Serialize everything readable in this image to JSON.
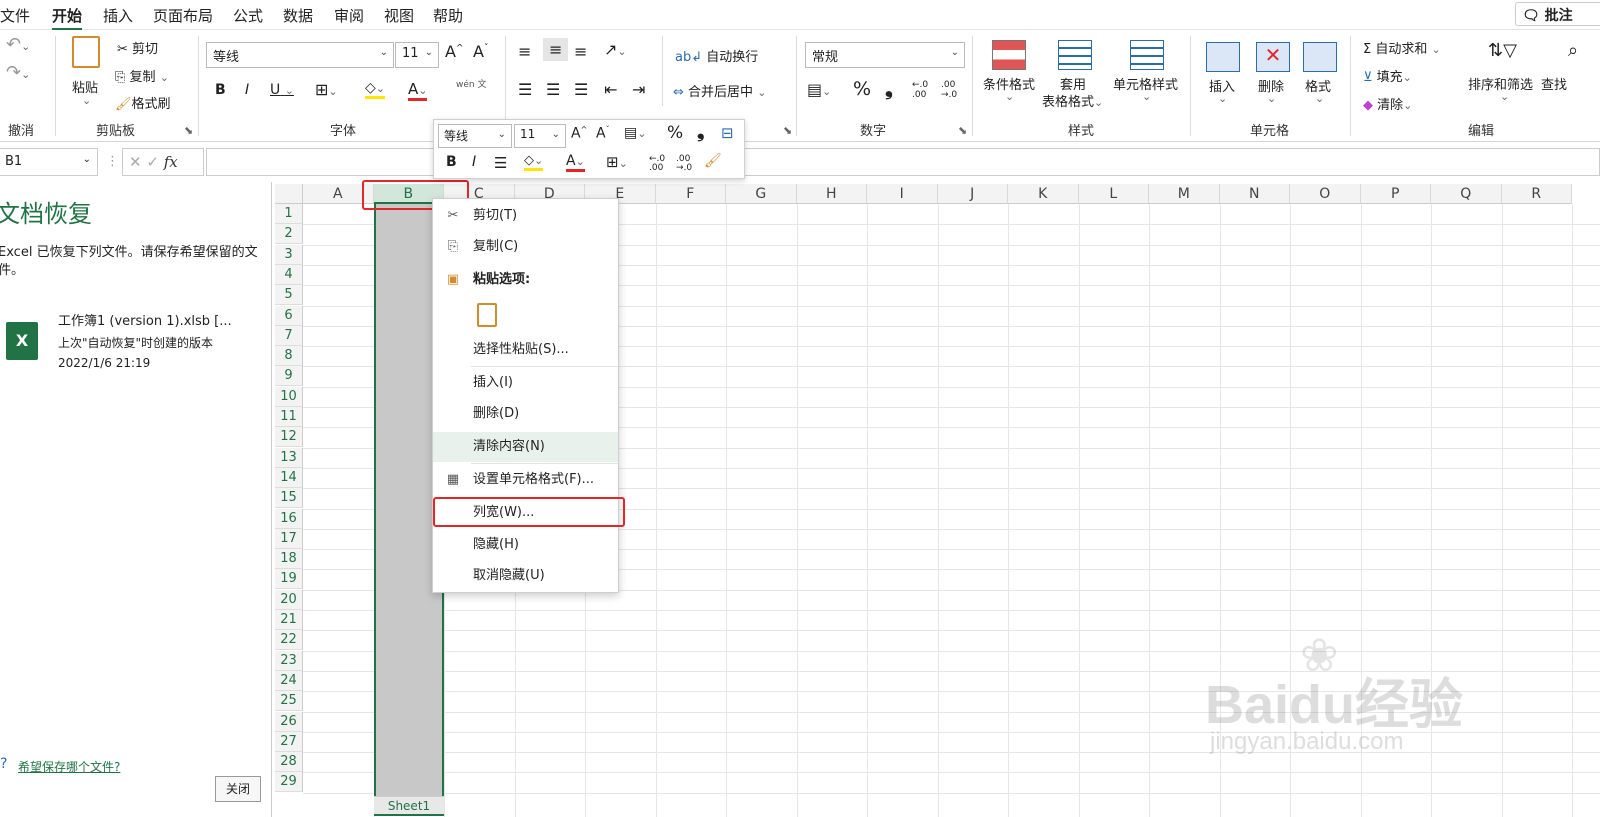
{
  "menu": {
    "tabs": [
      "文件",
      "开始",
      "插入",
      "页面布局",
      "公式",
      "数据",
      "审阅",
      "视图",
      "帮助"
    ],
    "active_tab": "开始",
    "comment_button": "批注"
  },
  "ribbon": {
    "undo_group": {
      "label": "撤消"
    },
    "clipboard": {
      "label": "剪贴板",
      "paste": "粘贴",
      "cut": "剪切",
      "copy": "复制",
      "format_painter": "格式刷"
    },
    "font": {
      "label": "字体",
      "font_name": "等线",
      "font_size": "11",
      "bold": "B",
      "italic": "I",
      "underline": "U",
      "font_color_letter": "A",
      "phonetic": "wén 文"
    },
    "alignment": {
      "wrap_text": "自动换行",
      "merge_center": "合并后居中"
    },
    "number": {
      "label": "数字",
      "format": "常规",
      "percent": "%",
      "comma": "❟",
      "inc_decimal": "←.0 .00",
      "dec_decimal": ".00 →.0"
    },
    "styles": {
      "label": "样式",
      "conditional": "条件格式",
      "format_table_1": "套用",
      "format_table_2": "表格格式",
      "cell_styles": "单元格样式"
    },
    "cells": {
      "label": "单元格",
      "insert": "插入",
      "delete": "删除",
      "format": "格式"
    },
    "editing": {
      "label": "编辑",
      "autosum": "自动求和",
      "fill": "填充",
      "clear": "清除",
      "sort_filter": "排序和筛选",
      "find": "查找"
    }
  },
  "formula_bar": {
    "name_box": "B1",
    "fx": "fx"
  },
  "recovery": {
    "title": "文档恢复",
    "description": "Excel 已恢复下列文件。请保存希望保留的文件。",
    "file_name": "工作簿1 (version 1).xlsb  [...",
    "file_note": "上次\"自动恢复\"时创建的版本",
    "file_time": "2022/1/6 21:19",
    "help_link": "希望保存哪个文件?",
    "close": "关闭"
  },
  "grid": {
    "columns": [
      "A",
      "B",
      "C",
      "D",
      "E",
      "F",
      "G",
      "H",
      "I",
      "J",
      "K",
      "L",
      "M",
      "N",
      "O",
      "P",
      "Q",
      "R"
    ],
    "rows": [
      "1",
      "2",
      "3",
      "4",
      "5",
      "6",
      "7",
      "8",
      "9",
      "10",
      "11",
      "12",
      "13",
      "14",
      "15",
      "16",
      "17",
      "18",
      "19",
      "20",
      "21",
      "22",
      "23",
      "24",
      "25",
      "26",
      "27",
      "28",
      "29"
    ],
    "sheet_tab": "Sheet1"
  },
  "mini_toolbar": {
    "font": "等线",
    "size": "11",
    "bold": "B",
    "italic": "I",
    "percent": "%",
    "comma": "❟",
    "font_color": "A"
  },
  "context_menu": {
    "items": [
      "剪切(T)",
      "复制(C)",
      "粘贴选项:",
      "选择性粘贴(S)...",
      "插入(I)",
      "删除(D)",
      "清除内容(N)",
      "设置单元格格式(F)...",
      "列宽(W)...",
      "隐藏(H)",
      "取消隐藏(U)"
    ],
    "highlighted": "清除内容(N)"
  },
  "watermark": {
    "brand": "Baidu经验",
    "url": "jingyan.baidu.com"
  },
  "colors": {
    "accent": "#217346",
    "highlight": "#e2262b",
    "selection": "#c8c8c8"
  }
}
